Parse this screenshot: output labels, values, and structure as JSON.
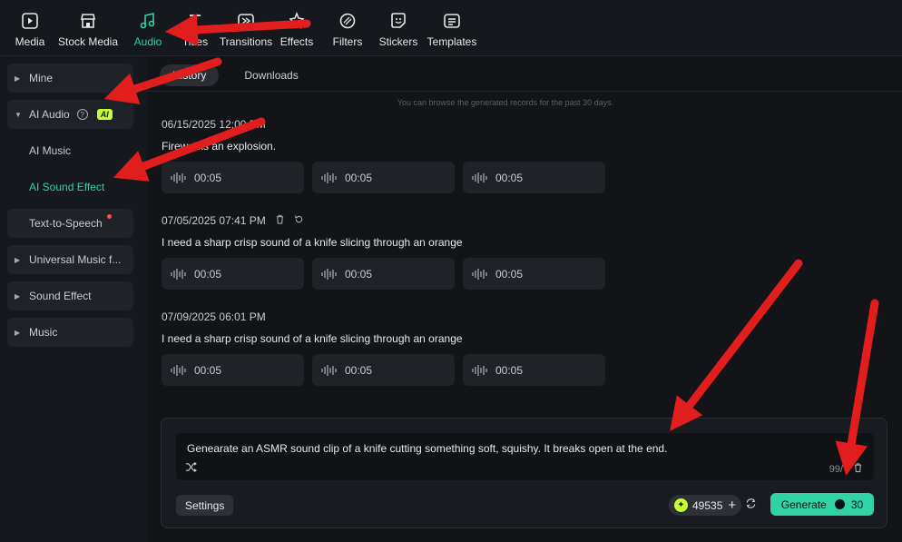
{
  "toolbar": {
    "items": [
      {
        "label": "Media",
        "icon": "media-icon"
      },
      {
        "label": "Stock Media",
        "icon": "stock-media-icon"
      },
      {
        "label": "Audio",
        "icon": "music-note-icon",
        "active": true
      },
      {
        "label": "Titles",
        "icon": "titles-icon"
      },
      {
        "label": "Transitions",
        "icon": "transitions-icon"
      },
      {
        "label": "Effects",
        "icon": "effects-icon"
      },
      {
        "label": "Filters",
        "icon": "filters-icon"
      },
      {
        "label": "Stickers",
        "icon": "stickers-icon"
      },
      {
        "label": "Templates",
        "icon": "templates-icon"
      }
    ]
  },
  "sidebar": {
    "mine": "Mine",
    "ai_audio": "AI Audio",
    "ai_badge": "AI",
    "ai_music": "AI Music",
    "ai_sound_effect": "AI Sound Effect",
    "text_to_speech": "Text-to-Speech",
    "universal_music": "Universal Music f...",
    "sound_effect": "Sound Effect",
    "music": "Music"
  },
  "tabs": {
    "history": "History",
    "downloads": "Downloads"
  },
  "notice": "You can browse the generated records for the past 30 days.",
  "records": [
    {
      "time": "06/15/2025 12:00 PM",
      "prompt": "Fireworks an explosion.",
      "clips": [
        "00:05",
        "00:05",
        "00:05"
      ]
    },
    {
      "time": "07/05/2025 07:41 PM",
      "prompt": "I need a sharp crisp sound of a knife slicing through an orange",
      "clips": [
        "00:05",
        "00:05",
        "00:05"
      ]
    },
    {
      "time": "07/09/2025 06:01 PM",
      "prompt": "I need a sharp crisp sound of a knife slicing through an orange",
      "clips": [
        "00:05",
        "00:05",
        "00:05"
      ]
    }
  ],
  "generator": {
    "prompt": "Genearate an ASMR sound clip of a knife cutting something soft, squishy. It breaks open at the end.",
    "char_count": "99/",
    "settings_label": "Settings",
    "credits": "49535",
    "generate_label": "Generate",
    "generate_cost": "30"
  },
  "colors": {
    "accent": "#2fd3a6",
    "ai_badge": "#c5ff3a",
    "annotation": "#e11d1d"
  }
}
